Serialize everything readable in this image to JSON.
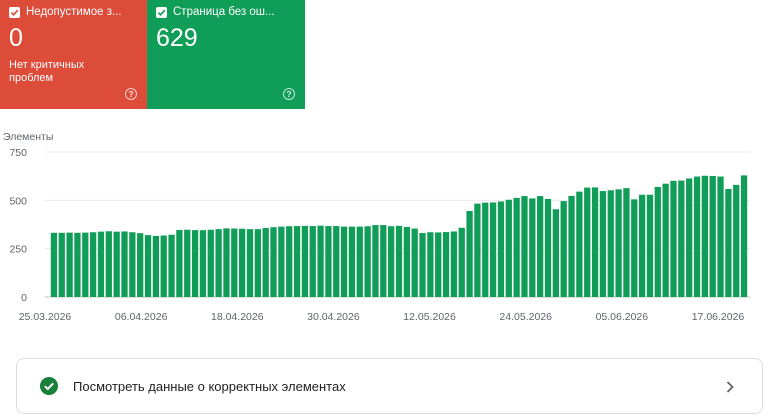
{
  "colors": {
    "error": "#dd4b39",
    "valid": "#0f9d58",
    "bar": "#0f9d58",
    "grid": "#e8eaed"
  },
  "cards": [
    {
      "title": "Недопустимое з...",
      "value": "0",
      "subtitle": "Нет критичных проблем",
      "help": "?"
    },
    {
      "title": "Страница без ош...",
      "value": "629",
      "help": "?"
    }
  ],
  "chart_data": {
    "type": "bar",
    "ylabel": "Элементы",
    "ylim": [
      0,
      750
    ],
    "yticks": [
      0,
      250,
      500,
      750
    ],
    "xticks": [
      "25.03.2026",
      "06.04.2026",
      "18.04.2026",
      "30.04.2026",
      "12.05.2026",
      "24.05.2026",
      "05.06.2026",
      "17.06.2026"
    ],
    "grid": true,
    "legend": "none",
    "series": [
      {
        "values": [
          332,
          332,
          333,
          332,
          333,
          335,
          338,
          340,
          338,
          339,
          335,
          330,
          320,
          316,
          318,
          322,
          347,
          348,
          346,
          346,
          348,
          351,
          355,
          354,
          353,
          351,
          351,
          357,
          361,
          364,
          366,
          367,
          368,
          367,
          369,
          367,
          367,
          364,
          364,
          364,
          366,
          372,
          372,
          366,
          368,
          362,
          354,
          331,
          335,
          334,
          336,
          339,
          358,
          445,
          483,
          488,
          489,
          494,
          503,
          513,
          522,
          510,
          522,
          507,
          454,
          496,
          523,
          545,
          566,
          567,
          548,
          552,
          557,
          563,
          505,
          529,
          529,
          569,
          586,
          601,
          602,
          613,
          623,
          627,
          626,
          623,
          559,
          580,
          629
        ]
      }
    ]
  },
  "link": {
    "label": "Посмотреть данные о корректных элементах"
  }
}
